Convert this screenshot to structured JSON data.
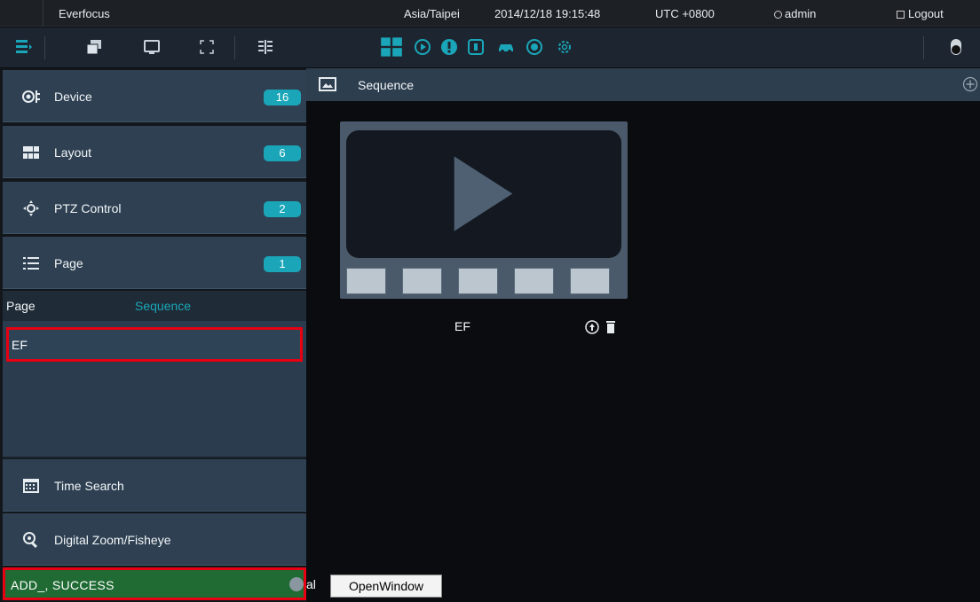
{
  "topbar": {
    "brand": "Everfocus",
    "timezone": "Asia/Taipei",
    "datetime": "2014/12/18 19:15:48",
    "utc": "UTC +0800",
    "user": "admin",
    "logout": "Logout"
  },
  "toolbar": {
    "left_icons": [
      "sidebar-toggle-icon",
      "multi-window-icon",
      "monitor-icon",
      "fullscreen-icon",
      "split-layout-icon"
    ],
    "center_icons": [
      "live-view-icon",
      "playback-icon",
      "alert-icon",
      "event-log-icon",
      "vehicle-icon",
      "face-icon",
      "settings-icon"
    ],
    "right_icon": "power-toggle-icon",
    "accent": "#1aa6b8"
  },
  "sidebar": {
    "device": {
      "label": "Device",
      "count": "16"
    },
    "layout": {
      "label": "Layout",
      "count": "6"
    },
    "ptz": {
      "label": "PTZ Control",
      "count": "2"
    },
    "page": {
      "label": "Page",
      "count": "1"
    },
    "subtabs": {
      "page": "Page",
      "sequence": "Sequence"
    },
    "page_items": [
      "EF"
    ],
    "time_search": "Time Search",
    "digital_zoom": "Digital Zoom/Fisheye",
    "status": "ADD_, SUCCESS"
  },
  "main": {
    "header_title": "Sequence",
    "sequence_name": "EF"
  },
  "overlay": {
    "prefix": "al",
    "open_window": "OpenWindow"
  }
}
